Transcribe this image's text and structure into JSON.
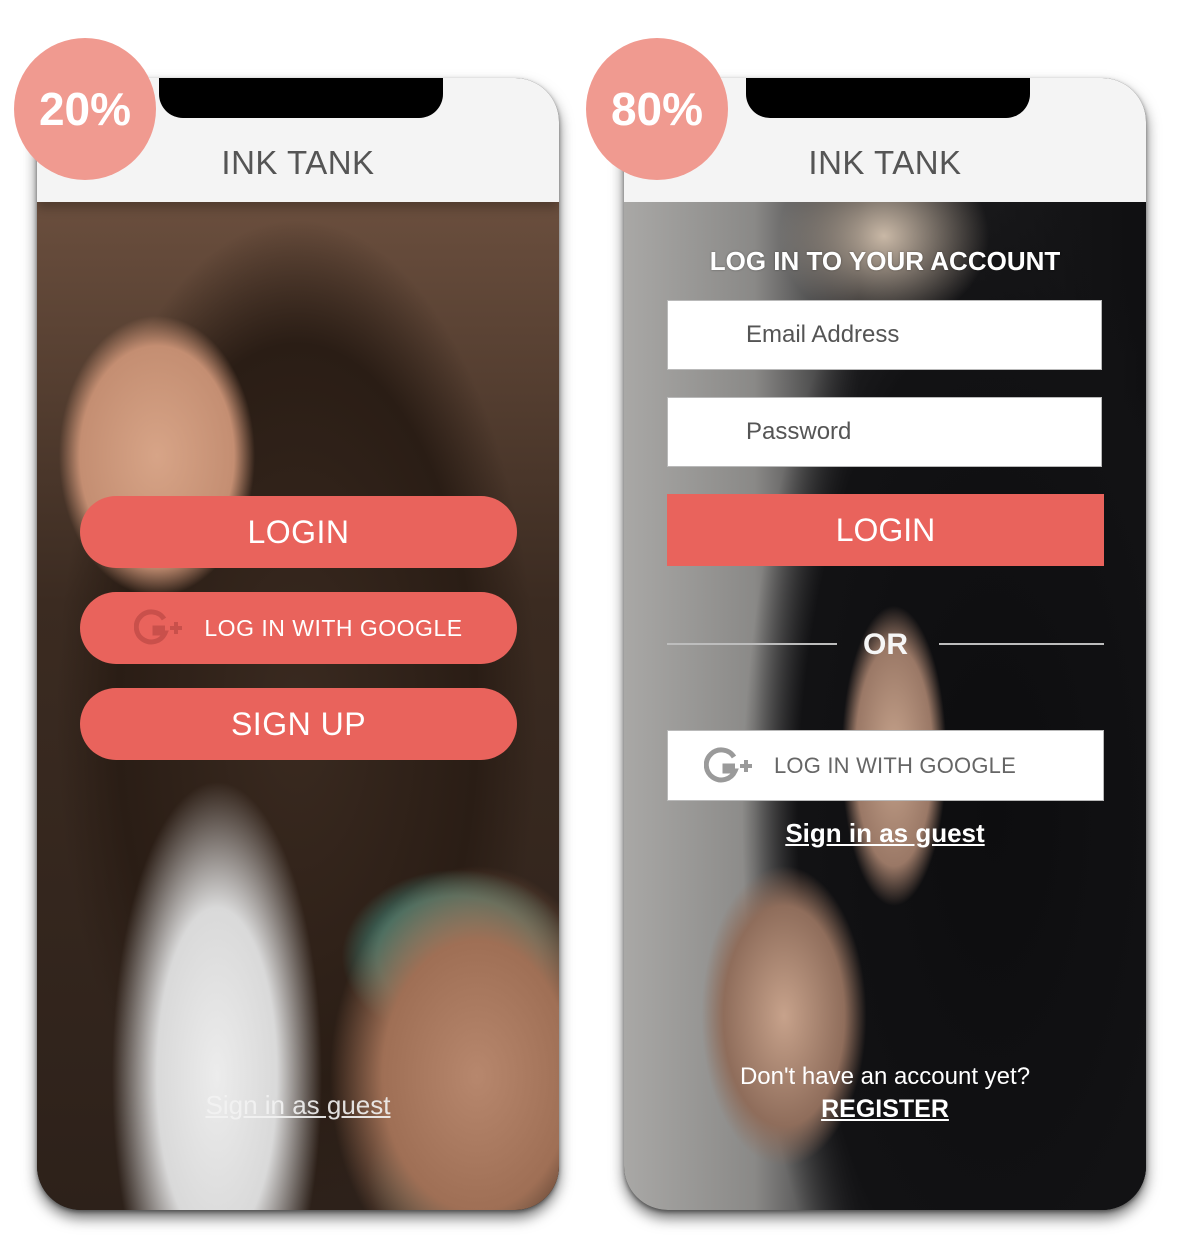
{
  "badges": {
    "left": "20%",
    "right": "80%"
  },
  "colors": {
    "accent": "#e9635c",
    "badge": "#f09a90",
    "header_bg": "#f4f4f4"
  },
  "screens": {
    "welcome": {
      "app_title": "INK TANK",
      "login_button": "LOGIN",
      "google_button": "LOG IN WITH GOOGLE",
      "google_icon": "google-plus-icon",
      "signup_button": "SIGN UP",
      "guest_link": "Sign in as guest"
    },
    "login": {
      "app_title": "INK TANK",
      "heading": "LOG IN TO YOUR ACCOUNT",
      "email_placeholder": "Email Address",
      "password_placeholder": "Password",
      "login_button": "LOGIN",
      "divider_text": "OR",
      "google_button": "LOG IN WITH GOOGLE",
      "google_icon": "google-plus-icon",
      "guest_link": "Sign in as guest",
      "register_prompt": "Don't have an account yet?",
      "register_link": "REGISTER"
    }
  }
}
